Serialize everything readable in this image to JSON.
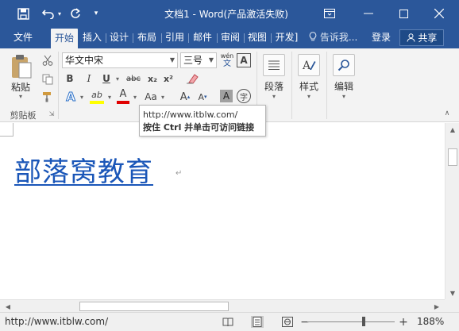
{
  "titlebar": {
    "title": "文档1 - Word(产品激活失败)",
    "quick_access": [
      {
        "icon": "save-icon",
        "glyph": "💾"
      },
      {
        "icon": "undo-icon",
        "glyph": "↶"
      },
      {
        "icon": "redo-icon",
        "glyph": "↻"
      },
      {
        "icon": "customize-qat-icon",
        "glyph": "▾"
      }
    ],
    "window_buttons": {
      "restore": "⧉",
      "minimize": "—",
      "maximize": "☐",
      "close": "✕"
    }
  },
  "tabs": [
    {
      "label": "文件"
    },
    {
      "label": "开始",
      "active": true
    },
    {
      "label": "插入"
    },
    {
      "label": "设计"
    },
    {
      "label": "布局"
    },
    {
      "label": "引用"
    },
    {
      "label": "邮件"
    },
    {
      "label": "审阅"
    },
    {
      "label": "视图"
    },
    {
      "label": "开发]"
    }
  ],
  "tellme": {
    "icon": "lightbulb-icon",
    "label": "告诉我..."
  },
  "account": {
    "login": "登录",
    "share": "共享"
  },
  "ribbon": {
    "clipboard": {
      "paste_label": "粘贴",
      "group_label": "剪贴板"
    },
    "font": {
      "font_name": "华文中宋",
      "font_size": "三号",
      "phonetic_top": "wén",
      "phonetic_bottom": "文",
      "charborder": "A",
      "bold": "B",
      "italic": "I",
      "underline": "U",
      "strike": "abc",
      "subscript": "x₂",
      "superscript": "x²",
      "texteffect": "A",
      "highlight": "ab",
      "fontcolor": "A",
      "changecase": "Aa",
      "grow": "A",
      "shrink": "A",
      "shading": "A",
      "enclose": "字"
    },
    "paragraph": {
      "label": "段落"
    },
    "styles": {
      "label": "样式"
    },
    "editing": {
      "label": "编辑"
    }
  },
  "tooltip": {
    "url": "http://www.itblw.com/",
    "hint": "按住 Ctrl 并单击可访问链接"
  },
  "document": {
    "link_text": "部落窝教育",
    "para_mark": "↵"
  },
  "statusbar": {
    "url": "http://www.itblw.com/",
    "zoom": "188%",
    "zoom_minus": "−",
    "zoom_plus": "+"
  },
  "colors": {
    "titlebar": "#2b579a",
    "hyperlink": "#1a56b8",
    "highlight_bar": "#ffff00",
    "fontcolor_bar": "#e00000"
  }
}
